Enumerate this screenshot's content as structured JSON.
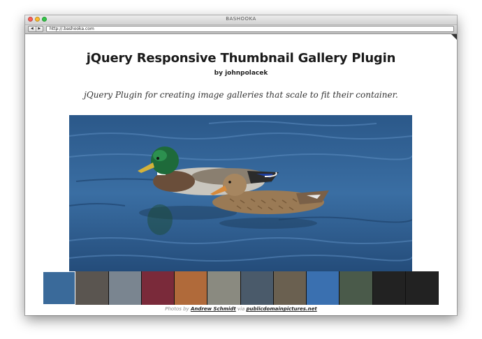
{
  "window": {
    "title": "BASHOOKA",
    "url": "http://.bashooka.com",
    "back_glyph": "◀",
    "forward_glyph": "▶"
  },
  "page": {
    "title": "jQuery Responsive Thumbnail Gallery Plugin",
    "byline": "by johnpolacek",
    "subtitle": "jQuery Plugin for creating image galleries that scale to fit their container."
  },
  "gallery": {
    "main_image": "mallard-ducks-on-water",
    "thumbnails": [
      {
        "name": "ducks",
        "color": "#3a6a9a",
        "active": true
      },
      {
        "name": "stone-wall",
        "color": "#5a5550"
      },
      {
        "name": "ferris-wheel",
        "color": "#7a8590"
      },
      {
        "name": "flowers",
        "color": "#7a2a3a"
      },
      {
        "name": "sunset",
        "color": "#b06a3a"
      },
      {
        "name": "seagull",
        "color": "#8a8a80"
      },
      {
        "name": "mountain-lake",
        "color": "#4a5a6a"
      },
      {
        "name": "owl",
        "color": "#6a6050"
      },
      {
        "name": "tree-sky",
        "color": "#3a70b0"
      },
      {
        "name": "bird-flight",
        "color": "#4a5a4a"
      },
      {
        "name": "empty-slot-1",
        "color": "#222222"
      },
      {
        "name": "empty-slot-2",
        "color": "#222222"
      }
    ]
  },
  "credit": {
    "prefix": "Photos by",
    "author": "Andrew Schmidt",
    "via": "via",
    "source": "publicdomainpictures.net"
  }
}
